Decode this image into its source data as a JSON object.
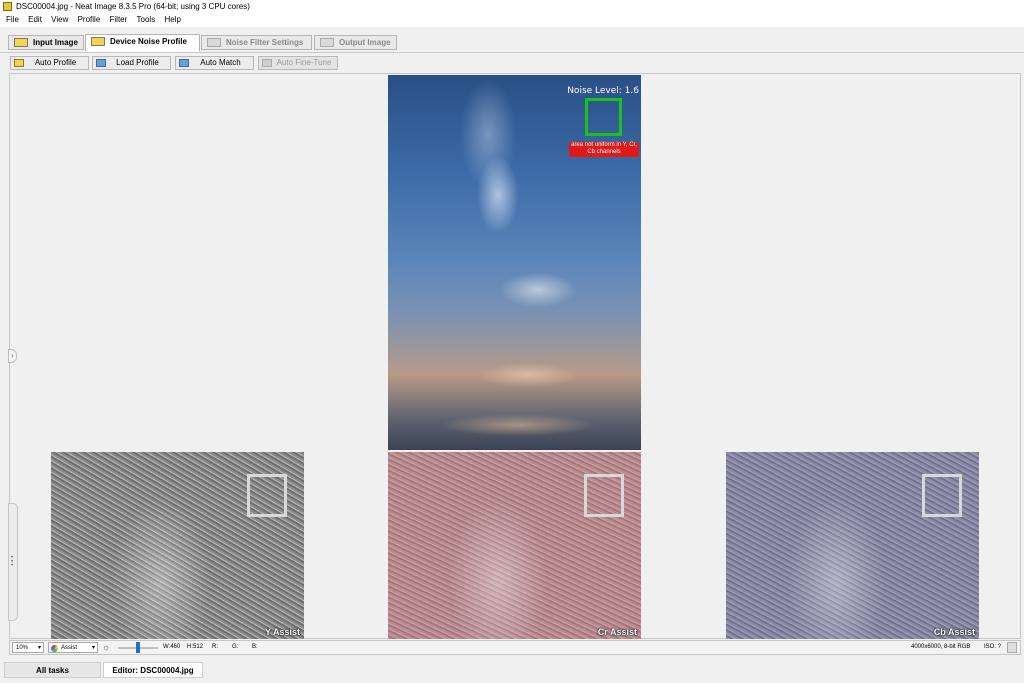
{
  "window": {
    "title": "DSC00004.jpg - Neat Image 8.3.5 Pro (64-bit; using 3 CPU cores)"
  },
  "menu": [
    "File",
    "Edit",
    "View",
    "Profile",
    "Filter",
    "Tools",
    "Help"
  ],
  "tabs": [
    {
      "label": "Input Image",
      "state": "normal"
    },
    {
      "label": "Device Noise Profile",
      "state": "active"
    },
    {
      "label": "Noise Filter Settings",
      "state": "disabled"
    },
    {
      "label": "Output Image",
      "state": "disabled"
    }
  ],
  "toolbar": {
    "auto_profile": "Auto Profile",
    "load_profile": "Load Profile",
    "auto_match": "Auto Match",
    "auto_fine_tune": "Auto Fine-Tune"
  },
  "image": {
    "noise_level": "Noise Level: 1.6",
    "warning": "area not uniform in Y, Cr, Cb channels",
    "sample_box_color": "#1bc21b",
    "warning_color": "#e01a1a"
  },
  "assist": {
    "y": "Y Assist",
    "cr": "Cr Assist",
    "cb": "Cb Assist"
  },
  "status": {
    "zoom": "10%",
    "view_mode": "Assist",
    "width": "W:460",
    "height": "H:512",
    "r": "R:",
    "g": "G:",
    "b": "B:",
    "image_info": "4000x6000, 8-bit RGB",
    "iso": "ISO: ?"
  },
  "bottom_tabs": {
    "all_tasks": "All tasks",
    "editor": "Editor: DSC00004.jpg"
  }
}
